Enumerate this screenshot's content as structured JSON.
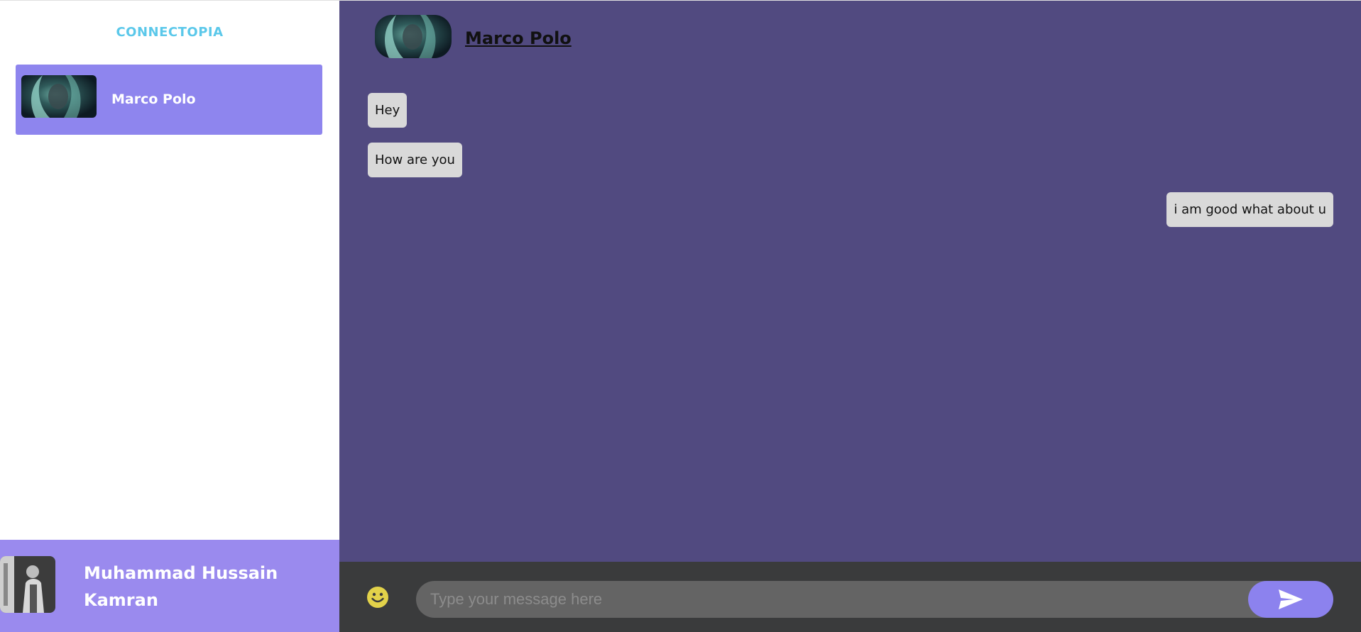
{
  "sidebar": {
    "brand": "CONNECTOPIA",
    "contacts": [
      {
        "name": "Marco Polo",
        "avatar": "contact-avatar-photo"
      }
    ],
    "current_user": {
      "name": "Muhammad Hussain Kamran",
      "avatar": "user-avatar-photo"
    }
  },
  "chat": {
    "header": {
      "name": "Marco Polo",
      "avatar": "contact-avatar-photo"
    },
    "messages": [
      {
        "text": "Hey",
        "side": "left"
      },
      {
        "text": "How are you",
        "side": "left"
      },
      {
        "text": "i am good what about u",
        "side": "right"
      }
    ]
  },
  "composer": {
    "placeholder": "Type your message here",
    "value": "",
    "emoji_icon": "smiley-icon",
    "send_icon": "send-icon"
  },
  "colors": {
    "brand": "#5bc8ea",
    "contact_active_bg": "#8e85ee",
    "user_footer_bg": "#9a8aee",
    "chat_bg": "#514a80",
    "bubble_bg": "#d9d9d9",
    "input_bar_bg": "#3a3b3c",
    "input_bg": "#646464",
    "send_button_bg": "#8c82ee"
  }
}
